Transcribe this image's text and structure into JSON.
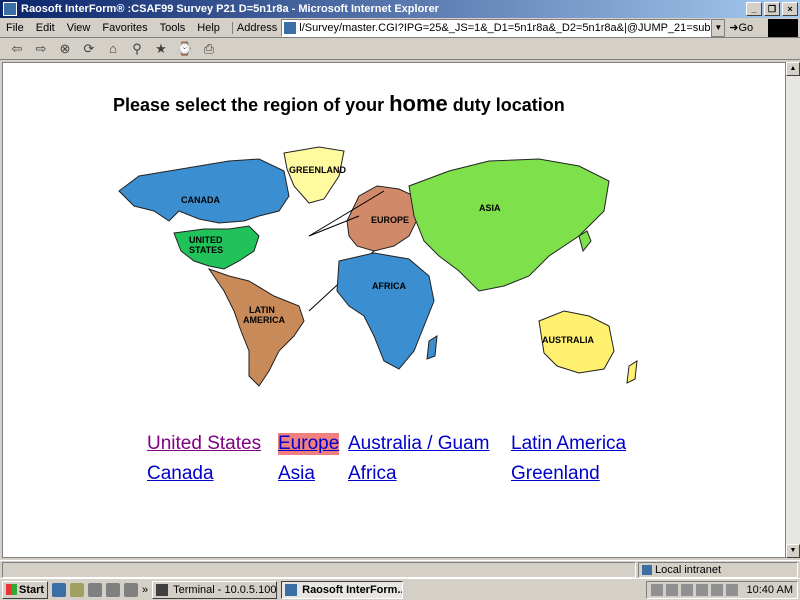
{
  "window": {
    "title": "Raosoft InterForm® :CSAF99 Survey P21 D=5n1r8a - Microsoft Internet Explorer"
  },
  "menu": [
    "File",
    "Edit",
    "View",
    "Favorites",
    "Tools",
    "Help"
  ],
  "address": {
    "label": "Address",
    "value": "l/Survey/master.CGI?IPG=25&_JS=1&_D1=5n1r8a&_D2=5n1r8a&|@JUMP_21=submit",
    "go_label": "Go"
  },
  "page": {
    "heading_pre": "Please select the region of your ",
    "heading_big": "home",
    "heading_post": " duty location",
    "map_labels": {
      "greenland": "GREENLAND",
      "canada": "CANADA",
      "united_states_1": "UNITED",
      "united_states_2": "STATES",
      "europe": "EUROPE",
      "asia": "ASIA",
      "africa": "AFRICA",
      "latin_america_1": "LATIN",
      "latin_america_2": "AMERICA",
      "australia": "AUSTRALIA"
    },
    "links": {
      "united_states": "United States",
      "europe": "Europe",
      "australia_guam": "Australia / Guam",
      "latin_america": "Latin America",
      "canada": "Canada",
      "asia": "Asia",
      "africa": "Africa",
      "greenland": "Greenland"
    }
  },
  "status": {
    "zone": "Local intranet"
  },
  "taskbar": {
    "start": "Start",
    "more": "»",
    "tasks": [
      "Terminal - 10.0.5.100",
      "Raosoft InterForm..."
    ],
    "clock": "10:40 AM"
  },
  "colors": {
    "north_america": "#3b8fd0",
    "united_states": "#22c25a",
    "greenland": "#fff9a0",
    "europe": "#d08a6a",
    "asia": "#7ee04a",
    "africa": "#3b8fd0",
    "latin_america": "#c98a5a",
    "australia": "#fff070"
  }
}
